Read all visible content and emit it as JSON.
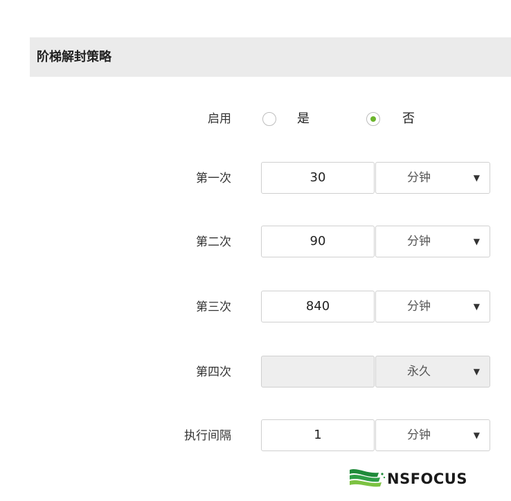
{
  "section": {
    "title": "阶梯解封策略"
  },
  "enable": {
    "label": "启用",
    "option_yes": "是",
    "option_no": "否",
    "selected": "否"
  },
  "rows": [
    {
      "label": "第一次",
      "value": "30",
      "unit": "分钟",
      "disabled": false
    },
    {
      "label": "第二次",
      "value": "90",
      "unit": "分钟",
      "disabled": false
    },
    {
      "label": "第三次",
      "value": "840",
      "unit": "分钟",
      "disabled": false
    },
    {
      "label": "第四次",
      "value": "",
      "unit": "永久",
      "disabled": true
    }
  ],
  "interval": {
    "label": "执行间隔",
    "value": "1",
    "unit": "分钟"
  },
  "logo": {
    "text": "NSFOCUS"
  },
  "colors": {
    "accent": "#6cb52d",
    "header_bg": "#ebebeb",
    "border": "#cfcfcf"
  }
}
